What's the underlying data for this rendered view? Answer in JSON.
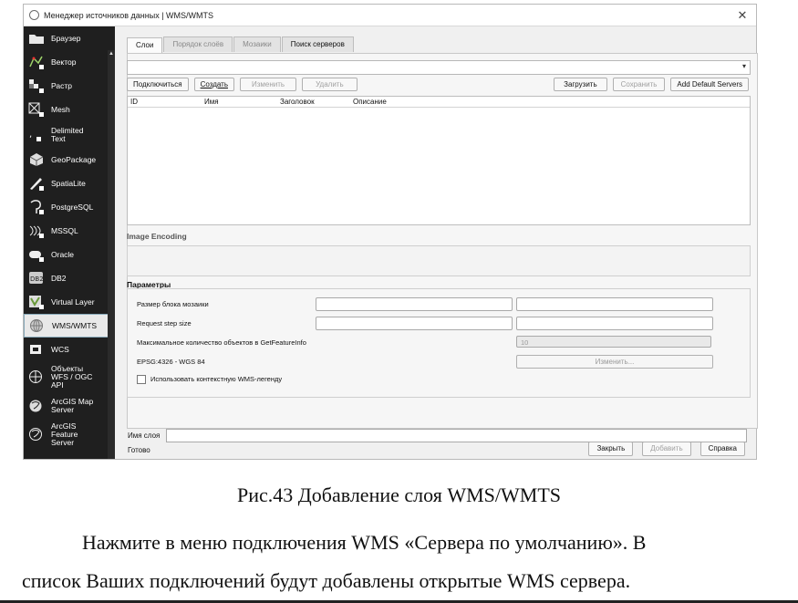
{
  "window": {
    "title": "Менеджер источников данных | WMS/WMTS",
    "close_glyph": "✕"
  },
  "sidebar": {
    "items": [
      {
        "label": "Браузер",
        "icon": "folder-icon"
      },
      {
        "label": "Вектор",
        "icon": "vector-icon"
      },
      {
        "label": "Растр",
        "icon": "raster-icon"
      },
      {
        "label": "Mesh",
        "icon": "mesh-icon"
      },
      {
        "label": "Delimited Text",
        "icon": "delimited-text-icon"
      },
      {
        "label": "GeoPackage",
        "icon": "geopackage-icon"
      },
      {
        "label": "SpatiaLite",
        "icon": "spatialite-icon"
      },
      {
        "label": "PostgreSQL",
        "icon": "postgresql-icon"
      },
      {
        "label": "MSSQL",
        "icon": "mssql-icon"
      },
      {
        "label": "Oracle",
        "icon": "oracle-icon"
      },
      {
        "label": "DB2",
        "icon": "db2-icon"
      },
      {
        "label": "Virtual Layer",
        "icon": "virtual-layer-icon"
      },
      {
        "label": "WMS/WMTS",
        "icon": "wms-icon",
        "selected": true
      },
      {
        "label": "WCS",
        "icon": "wcs-icon"
      },
      {
        "label": "Объекты WFS / OGC API",
        "icon": "wfs-icon"
      },
      {
        "label": "ArcGIS Map Server",
        "icon": "arcgis-map-icon"
      },
      {
        "label": "ArcGIS Feature Server",
        "icon": "arcgis-feature-icon"
      }
    ]
  },
  "tabs": [
    {
      "label": "Слои",
      "active": true
    },
    {
      "label": "Порядок слоёв"
    },
    {
      "label": "Мозаики"
    },
    {
      "label": "Поиск серверов"
    }
  ],
  "toolbar": {
    "connect": "Подключиться",
    "create": "Создать",
    "edit": "Изменить",
    "delete": "Удалить",
    "load": "Загрузить",
    "save": "Сохранить",
    "add_default": "Add Default Servers"
  },
  "table": {
    "columns": [
      "ID",
      "Имя",
      "Заголовок",
      "Описание"
    ]
  },
  "image_encoding": {
    "title": "Image Encoding"
  },
  "params": {
    "title": "Параметры",
    "tile_size": "Размер блока мозаики",
    "request_step": "Request step size",
    "max_features": "Максимальное количество объектов в GetFeatureInfo",
    "max_features_value": "10",
    "crs": "EPSG:4326 - WGS 84",
    "crs_button": "Изменить...",
    "legend_checkbox": "Использовать контекстную WMS-легенду"
  },
  "layer_name_label": "Имя слоя",
  "status": "Готово",
  "footer": {
    "close": "Закрыть",
    "add": "Добавить",
    "help": "Справка"
  },
  "document": {
    "caption": "Рис.43 Добавление слоя WMS/WMTS",
    "para_line1": "Нажмите в меню подключения WMS «Сервера по умолчанию». В",
    "para_line2": "список Ваших подключений будут добавлены открытые WMS сервера."
  }
}
